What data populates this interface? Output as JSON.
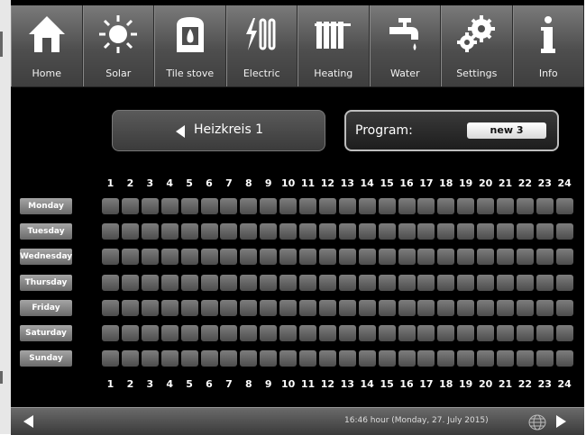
{
  "nav": [
    {
      "label": "Home",
      "icon": "home-icon"
    },
    {
      "label": "Solar",
      "icon": "sun-icon"
    },
    {
      "label": "Tile stove",
      "icon": "stove-icon"
    },
    {
      "label": "Electric",
      "icon": "electric-heater-icon"
    },
    {
      "label": "Heating",
      "icon": "radiator-icon"
    },
    {
      "label": "Water",
      "icon": "faucet-icon"
    },
    {
      "label": "Settings",
      "icon": "gears-icon"
    },
    {
      "label": "Info",
      "icon": "info-icon"
    }
  ],
  "circuit": {
    "label": "Heizkreis 1"
  },
  "program": {
    "label": "Program:",
    "value": "new 3"
  },
  "hours": [
    "1",
    "2",
    "3",
    "4",
    "5",
    "6",
    "7",
    "8",
    "9",
    "10",
    "11",
    "12",
    "13",
    "14",
    "15",
    "16",
    "17",
    "18",
    "19",
    "20",
    "21",
    "22",
    "23",
    "24"
  ],
  "days": [
    "Monday",
    "Tuesday",
    "Wednesday",
    "Thursday",
    "Friday",
    "Saturday",
    "Sunday"
  ],
  "status": {
    "text": "16:46 hour (Monday, 27. July 2015)"
  },
  "colors": {
    "cell": "#5e5e5e",
    "background": "#000000",
    "nav": "#5a5a5a"
  }
}
